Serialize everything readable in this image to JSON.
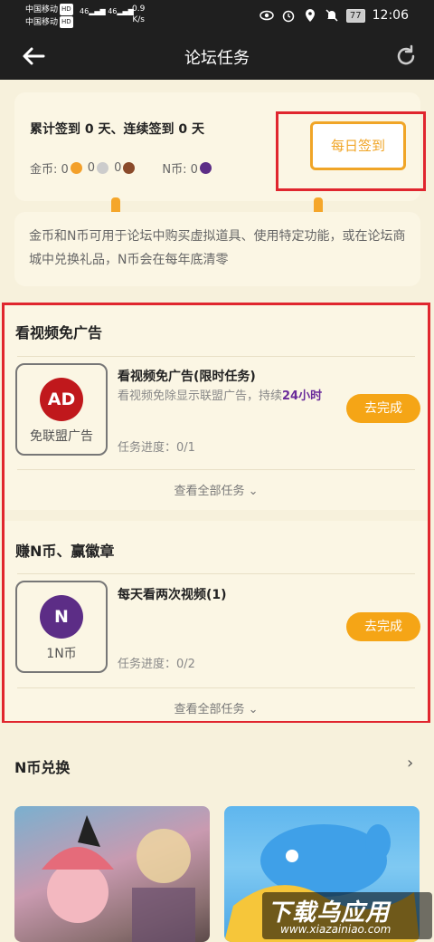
{
  "status_bar": {
    "carrier1": "中国移动",
    "carrier2": "中国移动",
    "hd": "HD",
    "signal1": "46",
    "signal2": "46",
    "speed": "0.9",
    "speed_unit": "K/s",
    "battery": "77",
    "time": "12:06"
  },
  "header": {
    "title": "论坛任务"
  },
  "checkin": {
    "summary": "累计签到 0 天、连续签到 0 天",
    "gold_label": "金币: 0",
    "n_label": "N币: 0",
    "button": "每日签到"
  },
  "info": {
    "text": "金币和N币可用于论坛中购买虚拟道具、使用特定功能，或在论坛商城中兑换礼品，N币会在每年底清零"
  },
  "sections": [
    {
      "title": "看视频免广告",
      "task": {
        "badge": "AD",
        "thumb_label": "免联盟广告",
        "name": "看视频免广告(限时任务)",
        "desc": "看视频免除显示联盟广告，持续",
        "desc_highlight": "24小时",
        "progress": "任务进度：0/1",
        "button": "去完成"
      },
      "view_all": "查看全部任务"
    },
    {
      "title": "赚N币、赢徽章",
      "task": {
        "badge": "N",
        "thumb_label": "1N币",
        "name": "每天看两次视频(1)",
        "progress": "任务进度：0/2",
        "button": "去完成"
      },
      "view_all": "查看全部任务"
    }
  ],
  "exchange": {
    "title": "N币兑换",
    "arrow": "›"
  },
  "watermark": {
    "main": "下载乌应用",
    "sub": "www.xiazainiao.com"
  },
  "colors": {
    "accent": "#f5a516",
    "highlight_frame": "#e0262e",
    "ad_badge": "#c0181c",
    "n_badge": "#5c2d86"
  }
}
